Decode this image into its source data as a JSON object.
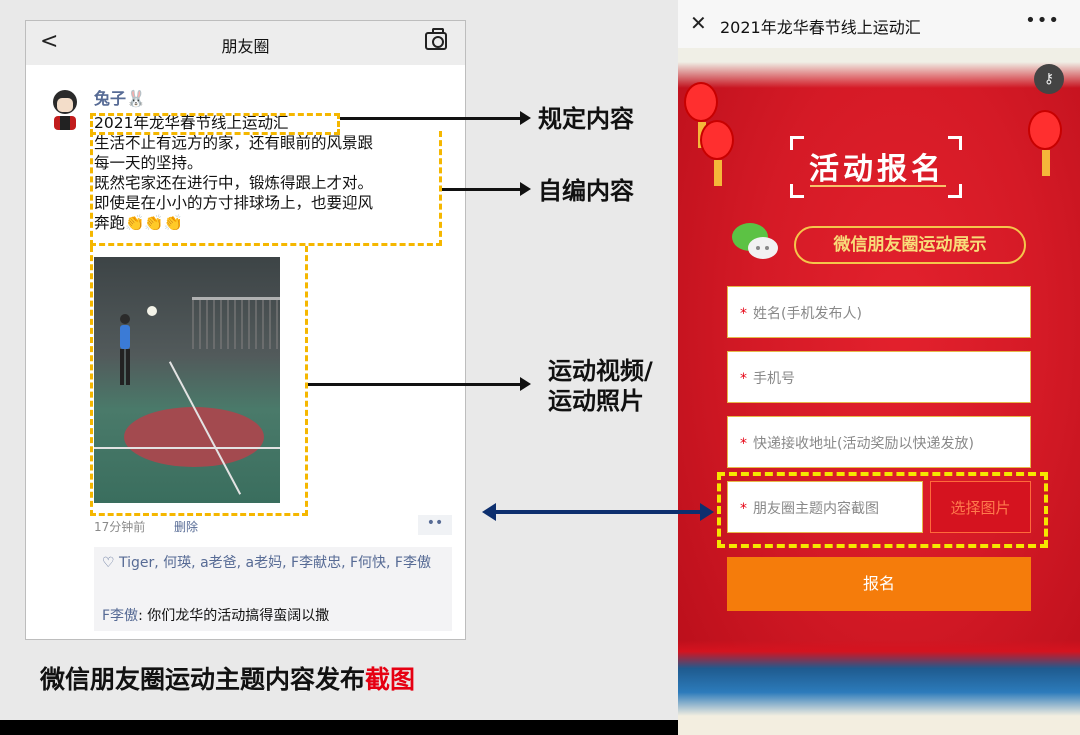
{
  "left": {
    "header": {
      "title": "朋友圈"
    },
    "post": {
      "username": "兔子🐰",
      "lines": [
        "2021年龙华春节线上运动汇",
        "生活不止有远方的家，还有眼前的风景跟",
        "每一天的坚持。",
        "既然宅家还在进行中，锻炼得跟上才对。",
        "即使是在小小的方寸排球场上，也要迎风",
        "奔跑👏👏👏"
      ],
      "time": "17分钟前",
      "delete_label": "删除",
      "more_label": "••",
      "likes": "♡ Tiger, 何瑛, a老爸, a老妈, F李献忠, F何快, F李傲",
      "comment_author": "F李傲",
      "comment_text": ": 你们龙华的活动搞得蛮阔以撒"
    },
    "annotations": {
      "fixed": "规定内容",
      "custom": "自编内容",
      "media_line1": "运动视频/",
      "media_line2": "运动照片"
    },
    "caption": {
      "main": "微信朋友圈运动主题内容发布",
      "highlight": "截图"
    }
  },
  "right": {
    "topbar": {
      "title": "2021年龙华春节线上运动汇",
      "close": "✕",
      "more": "•••"
    },
    "banner_title": "活动报名",
    "subtitle": "微信朋友圈运动展示",
    "fields": {
      "name": "姓名(手机发布人)",
      "phone": "手机号",
      "address": "快递接收地址(活动奖励以快递发放)",
      "screenshot": "朋友圈主题内容截图"
    },
    "required_mark": "*",
    "upload_button": "选择图片",
    "submit_button": "报名"
  },
  "colors": {
    "brand_red": "#d5131f",
    "submit_orange": "#f57c0b",
    "annotation_yellow": "#f5b700",
    "link_blue": "#576b95"
  }
}
